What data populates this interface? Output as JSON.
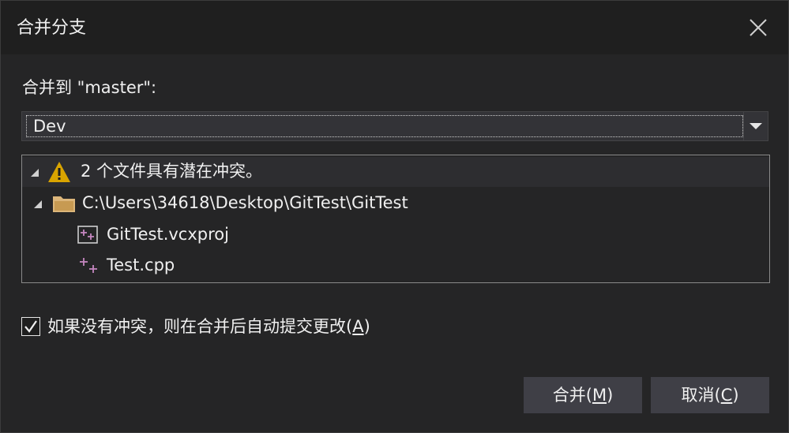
{
  "dialog": {
    "title": "合并分支",
    "close_icon": "close-icon"
  },
  "merge_target": {
    "label": "合并到 \"master\":",
    "selected_branch": "Dev",
    "dropdown_icon": "chevron-down-icon"
  },
  "conflicts": {
    "summary": "2 个文件具有潜在冲突。",
    "path": "C:\\Users\\34618\\Desktop\\GitTest\\GitTest",
    "files": [
      {
        "name": "GitTest.vcxproj",
        "icon": "project-file-icon"
      },
      {
        "name": "Test.cpp",
        "icon": "cpp-file-icon"
      }
    ]
  },
  "auto_commit": {
    "checked": true,
    "label_prefix": "如果没有冲突，则在合并后自动提交更改(",
    "accelerator": "A",
    "label_suffix": ")"
  },
  "buttons": {
    "merge": {
      "prefix": "合并(",
      "accelerator": "M",
      "suffix": ")"
    },
    "cancel": {
      "prefix": "取消(",
      "accelerator": "C",
      "suffix": ")"
    }
  },
  "colors": {
    "background": "#252526",
    "titlebar": "#1f1f1f",
    "button": "#3f3f46",
    "warning": "#d9a400",
    "folder": "#dcb67a",
    "file_accent": "#c586c0"
  }
}
